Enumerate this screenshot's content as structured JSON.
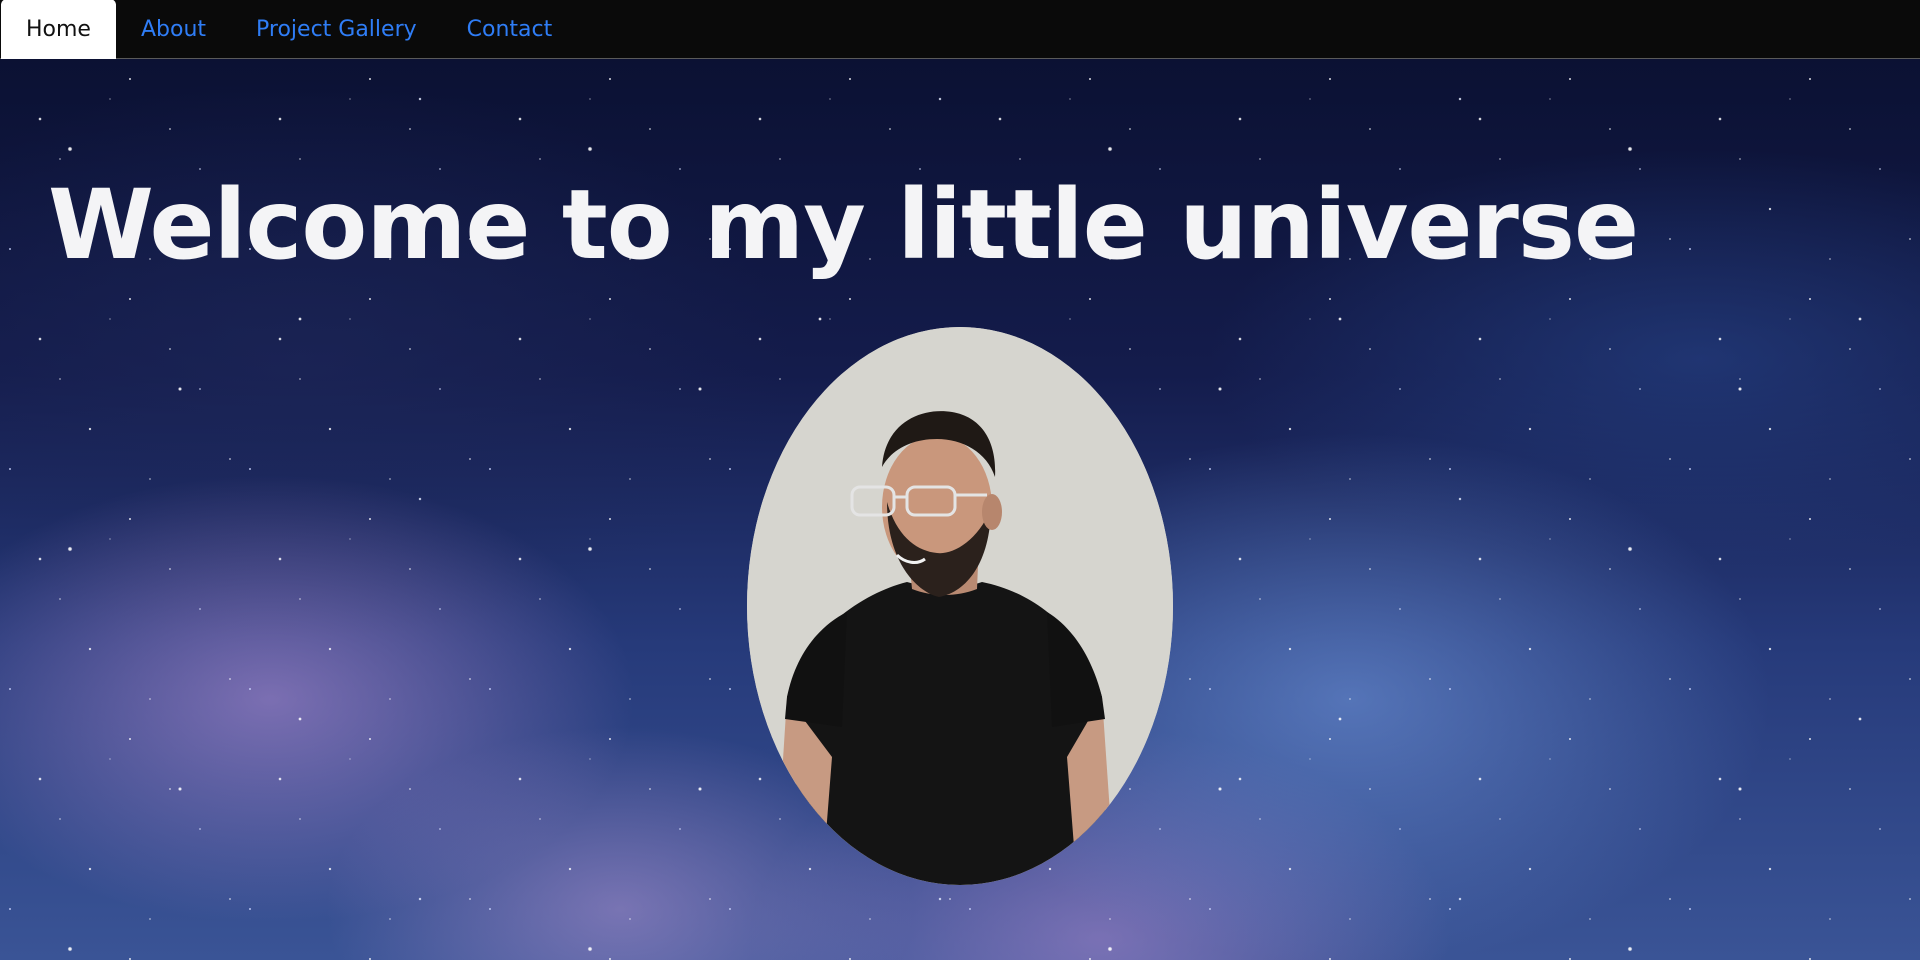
{
  "nav": {
    "items": [
      {
        "label": "Home",
        "active": true
      },
      {
        "label": "About",
        "active": false
      },
      {
        "label": "Project Gallery",
        "active": false
      },
      {
        "label": "Contact",
        "active": false
      }
    ],
    "link_color": "#2f7df6",
    "active_bg": "#ffffff",
    "bar_bg": "#0a0a0a"
  },
  "hero": {
    "heading": "Welcome to my little universe",
    "background": "starry-galaxy-image",
    "portrait": "oval-portrait-photo"
  }
}
